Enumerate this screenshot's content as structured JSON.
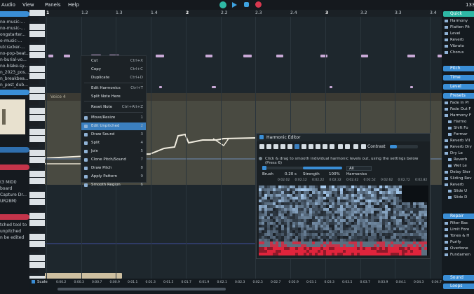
{
  "menubar": {
    "items": [
      "Audio",
      "View",
      "Panels",
      "Help"
    ],
    "counter": "133"
  },
  "left_panel": {
    "files": [
      "no-music-...",
      "no-music-...",
      "ongstarter...",
      "o-music-...",
      "utcracker-...",
      "no-pop-beat...",
      "n-burial-vo...",
      "no-blake-sy...",
      "n_2023_pos...",
      "n_breakbea...",
      "n_post_dub..."
    ],
    "device_rows": [
      "(3 MIDI)",
      "board",
      "Capture Dr...",
      "UR28M)"
    ],
    "hint_lines": [
      "tched tool to",
      "unpitched",
      "n be edited"
    ]
  },
  "ruler": {
    "bars": [
      "1",
      "1.2",
      "1.3",
      "1.4",
      "2",
      "2.2",
      "2.3",
      "2.4",
      "3",
      "3.2",
      "3.3",
      "3.4",
      "4",
      "4.2",
      "4.3",
      "4.4"
    ]
  },
  "voice_label": "Voice 4",
  "context_menu": {
    "items": [
      {
        "label": "Cut",
        "shortcut": "Ctrl+X"
      },
      {
        "label": "Copy",
        "shortcut": "Ctrl+C"
      },
      {
        "label": "Duplicate",
        "shortcut": "Ctrl+D"
      },
      {
        "label": "Edit Harmonics",
        "shortcut": "Ctrl+T"
      },
      {
        "label": "Split Note Here",
        "shortcut": ""
      },
      {
        "label": "Reset Note",
        "shortcut": "Ctrl+Alt+Z"
      },
      {
        "label": "Move/Resize",
        "shortcut": "1"
      },
      {
        "label": "Edit Unpitched",
        "shortcut": "2"
      },
      {
        "label": "Draw Sound",
        "shortcut": "3"
      },
      {
        "label": "Split",
        "shortcut": "4"
      },
      {
        "label": "Join",
        "shortcut": "5"
      },
      {
        "label": "Clone Pitch/Sound",
        "shortcut": "7"
      },
      {
        "label": "Draw Pitch",
        "shortcut": "8"
      },
      {
        "label": "Apply Pattern",
        "shortcut": "9"
      },
      {
        "label": "Smooth Region",
        "shortcut": "6"
      }
    ]
  },
  "harmonic_editor": {
    "title": "Harmonic Editor",
    "contrast_label": "Contrast",
    "info": "Click & drag to smooth individual harmonic levels out, using the settings below (Press 6)",
    "brush_label": "Brush",
    "brush_value": "0.20 s",
    "strength_label": "Strength",
    "strength_value": "100%",
    "harmonics_label": "Harmonics",
    "harmonics_value": "All",
    "time_ticks": [
      "0:02.02",
      "0:02.12",
      "0:02.22",
      "0:02.32",
      "0:02.42",
      "0:02.52",
      "0:02.62",
      "0:02.72",
      "0:02.82"
    ]
  },
  "right_panel": {
    "quick_label": "Quick",
    "quick_items": [
      "Harmony",
      "Flatten Pit",
      "Level",
      "Reverb",
      "Vibrato",
      "Chorus"
    ],
    "pitch_label": "Pitch",
    "time_label": "Time",
    "level_label": "Level",
    "presets_label": "Presets",
    "preset_items": [
      "Fade In Pr",
      "Fade Out F",
      "Harmony F",
      "Harmo",
      "Shift Fo",
      "Formar",
      "Reverb VII",
      "Reverb Dry",
      "Dry Le",
      "Reverb",
      "Wet Le",
      "Delay Ster",
      "Sliding Rev",
      "Reverb",
      "Slide U",
      "Slide D"
    ],
    "repair_label": "Repair",
    "repair_items": [
      "Filter Bac",
      "Limit Fore",
      "Tones & H",
      "Purify",
      "Overtone",
      "Fundamen"
    ],
    "sound_label": "Sound",
    "loops_label": "Loops"
  },
  "bottom_bar": {
    "scale_label": "Scale",
    "time_ticks": [
      "0:00.2",
      "0:00.3",
      "0:00.7",
      "0:00.9",
      "0:01.1",
      "0:01.3",
      "0:01.5",
      "0:01.7",
      "0:01.9",
      "0:02.1",
      "0:02.3",
      "0:02.5",
      "0:02.7",
      "0:02.9",
      "0:03.1",
      "0:03.3",
      "0:03.5",
      "0:03.7",
      "0:03.9",
      "0:04.1",
      "0:04.3",
      "0:04.7"
    ]
  },
  "colors": {
    "accent_blue": "#3a8ed6",
    "accent_teal": "#2eb8a5",
    "menu_highlight": "#3b7fbf",
    "note_lilac": "#c9a9d6",
    "record_red": "#d8384f"
  }
}
